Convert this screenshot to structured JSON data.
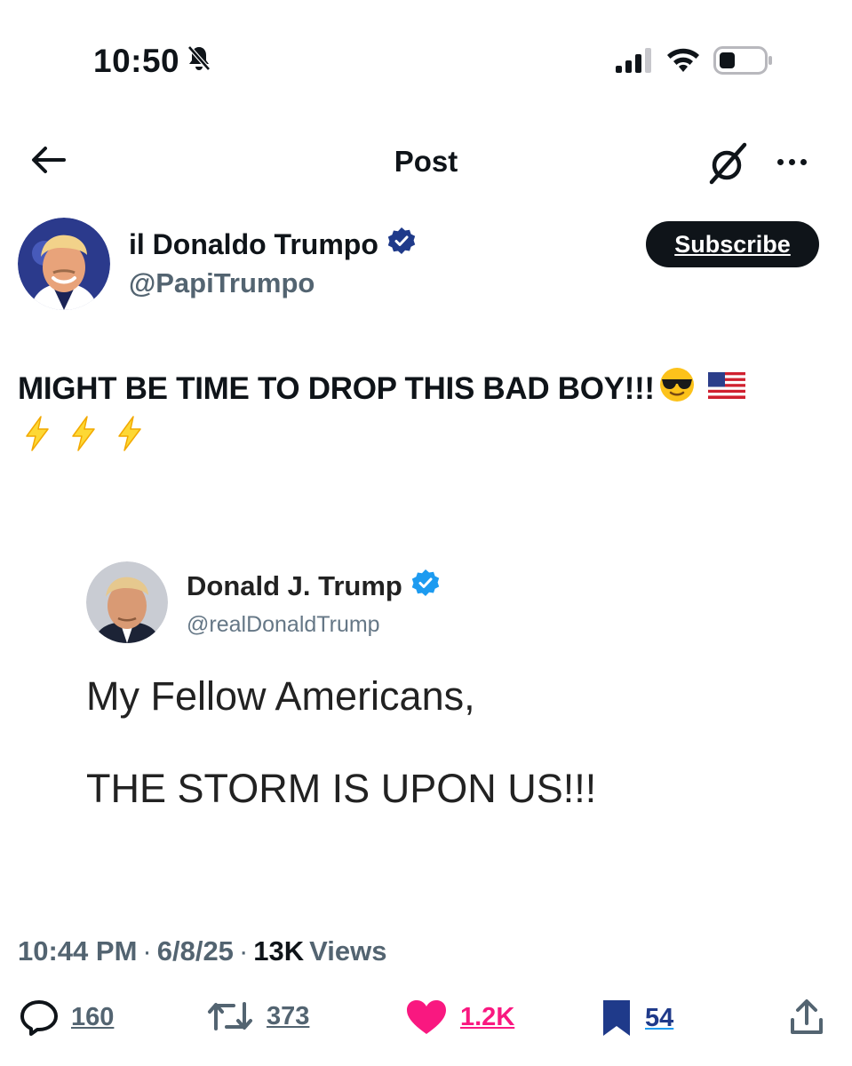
{
  "status_bar": {
    "time": "10:50",
    "icons": [
      "bell-slash-icon",
      "cellular-signal-icon",
      "wifi-icon",
      "battery-icon"
    ]
  },
  "header": {
    "title": "Post",
    "back_icon": "arrow-left-icon",
    "grok_icon": "grok-icon",
    "more_icon": "more-horizontal-icon"
  },
  "author": {
    "display_name": "il Donaldo Trumpo",
    "handle": "@PapiTrumpo",
    "verified_icon": "verified-badge-icon",
    "subscribe_label": "Subscribe"
  },
  "post": {
    "text": "MIGHT BE TIME TO DROP THIS BAD BOY!!!",
    "emoji_icons": [
      "sunglasses-emoji-icon",
      "us-flag-emoji-icon",
      "lightning-emoji-icon",
      "lightning-emoji-icon",
      "lightning-emoji-icon"
    ]
  },
  "embedded_tweet": {
    "display_name": "Donald J. Trump",
    "handle": "@realDonaldTrump",
    "line1": "My Fellow Americans,",
    "line2": "THE STORM IS UPON US!!!"
  },
  "meta": {
    "time": "10:44 PM",
    "separator": "·",
    "date": "6/8/25",
    "views_count": "13K",
    "views_label": "Views"
  },
  "actions": {
    "replies": "160",
    "reposts": "373",
    "likes": "1.2K",
    "bookmarks": "54"
  },
  "colors": {
    "text_primary": "#0f1419",
    "text_secondary": "#536471",
    "like_pink": "#f91880",
    "verified_blue": "#1d9bf0",
    "bookmark_navy": "#1f3a8a"
  }
}
